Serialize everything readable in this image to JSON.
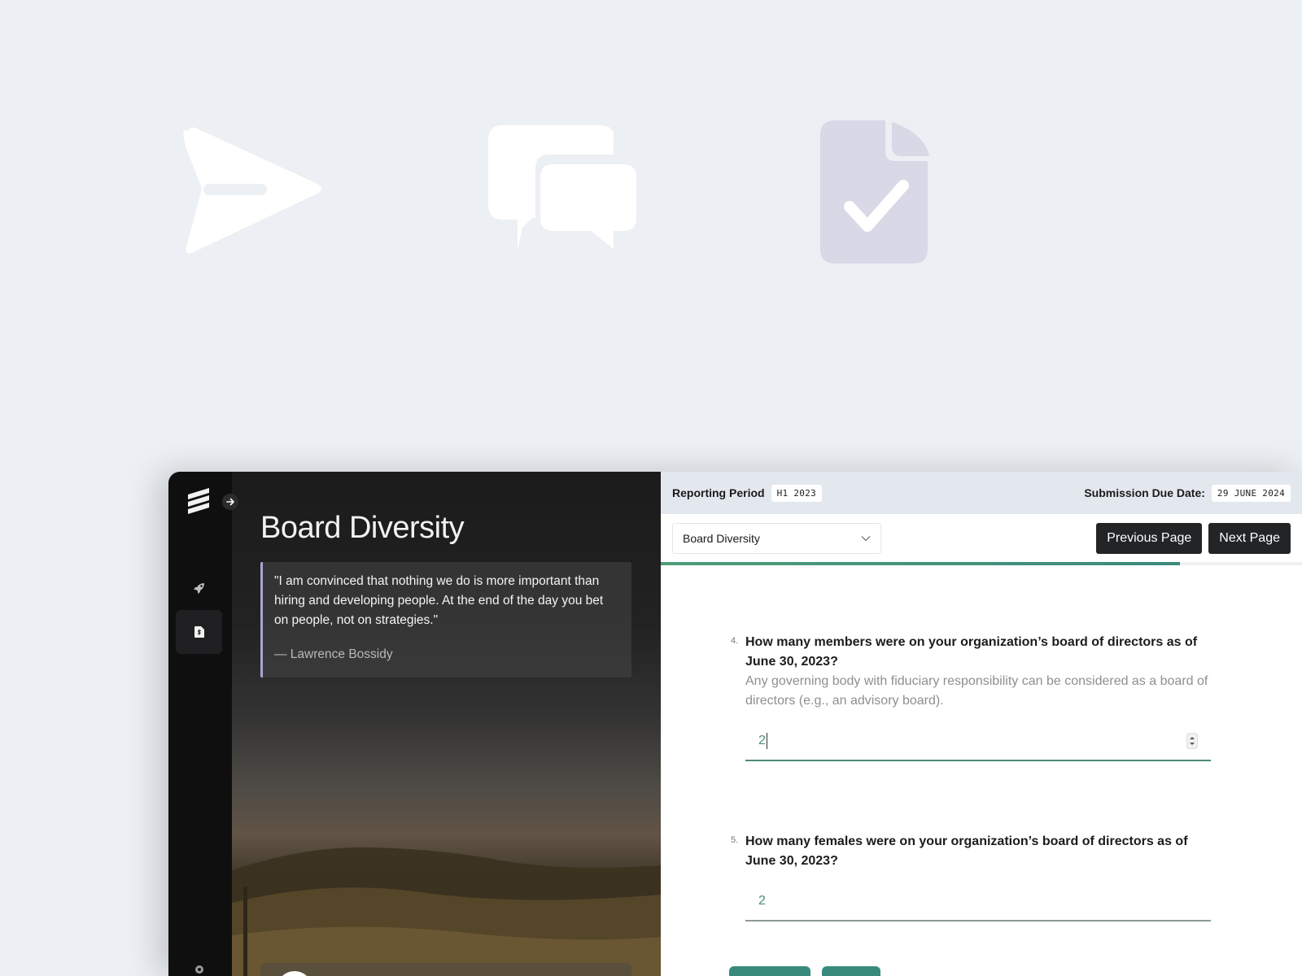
{
  "hero": {
    "icons": [
      "paper-plane-icon",
      "chat-bubbles-icon",
      "document-check-icon"
    ]
  },
  "rail": {
    "logo": "stacked-flags-logo",
    "expand_icon": "arrow-right-icon",
    "items": [
      {
        "icon": "rocket-icon",
        "active": false
      },
      {
        "icon": "document-dollar-icon",
        "active": true
      }
    ]
  },
  "hero_panel": {
    "title": "Board Diversity",
    "quote": "\"I am convinced that nothing we do is more important than hiring and developing people. At the end of the day you bet on people, not on strategies.\"",
    "author": "— Lawrence Bossidy"
  },
  "topbar": {
    "period_label": "Reporting Period",
    "period_value": "H1 2023",
    "due_label": "Submission Due Date:",
    "due_value": "29 JUNE 2024"
  },
  "toolbar": {
    "section_selected": "Board Diversity",
    "prev_label": "Previous Page",
    "next_label": "Next Page",
    "progress": 0.81
  },
  "questions": [
    {
      "number": "4.",
      "text": "How many members were on your organization’s board of directors as of June 30, 2023?",
      "hint": "Any governing body with fiduciary responsibility can be considered as a board of directors (e.g., an advisory board).",
      "value": "2"
    },
    {
      "number": "5.",
      "text": "How many females were on your organization’s board of directors as of June 30, 2023?",
      "value": "2"
    }
  ],
  "colors": {
    "accent": "#3a8a7c",
    "dark_button": "#222426",
    "topbar_bg": "#e3e8ee",
    "quote_border": "#a6a7d6"
  }
}
